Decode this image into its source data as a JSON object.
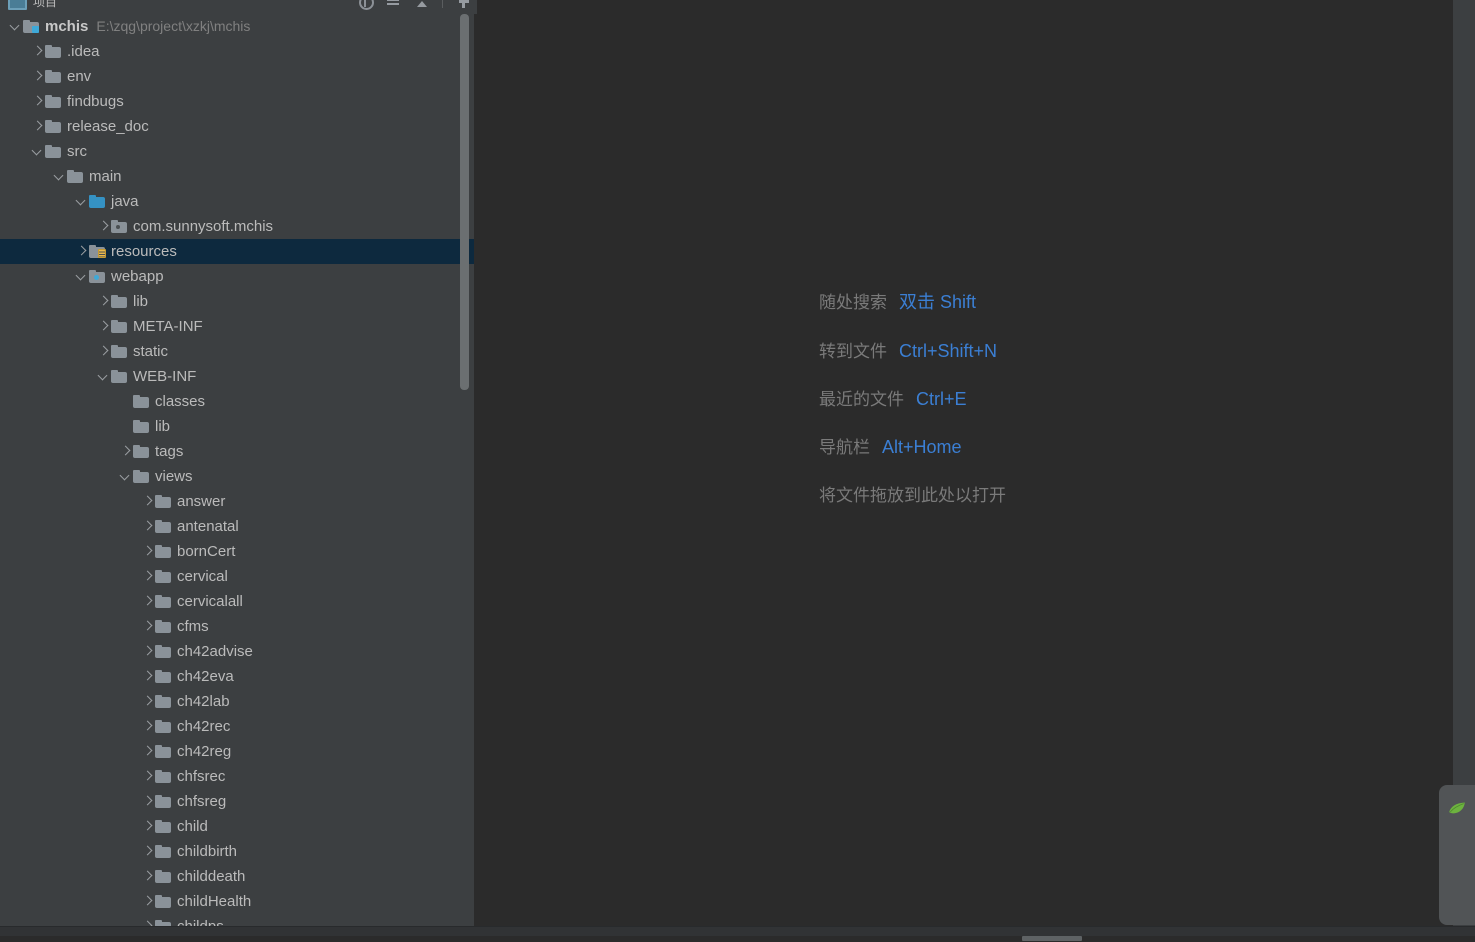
{
  "window": {
    "tool_window_title": "项目",
    "toolbar_icons": [
      "locate-icon",
      "collapse-all-icon",
      "hide-icon",
      "settings-icon"
    ]
  },
  "project_tree": {
    "root": {
      "name": "mchis",
      "path": "E:\\zqg\\project\\xzkj\\mchis"
    },
    "nodes": [
      {
        "label": "mchis",
        "path": "E:\\zqg\\project\\xzkj\\mchis",
        "indent": 0,
        "arrow": "down",
        "icon": "module-root-folder-icon",
        "bold": true,
        "selected": false
      },
      {
        "label": ".idea",
        "indent": 1,
        "arrow": "right",
        "icon": "folder-icon",
        "bold": false,
        "selected": false
      },
      {
        "label": "env",
        "indent": 1,
        "arrow": "right",
        "icon": "folder-icon",
        "bold": false,
        "selected": false
      },
      {
        "label": "findbugs",
        "indent": 1,
        "arrow": "right",
        "icon": "folder-icon",
        "bold": false,
        "selected": false
      },
      {
        "label": "release_doc",
        "indent": 1,
        "arrow": "right",
        "icon": "folder-icon",
        "bold": false,
        "selected": false
      },
      {
        "label": "src",
        "indent": 1,
        "arrow": "down",
        "icon": "folder-icon",
        "bold": false,
        "selected": false
      },
      {
        "label": "main",
        "indent": 2,
        "arrow": "down",
        "icon": "folder-icon",
        "bold": false,
        "selected": false
      },
      {
        "label": "java",
        "indent": 3,
        "arrow": "down",
        "icon": "source-root-folder-icon",
        "bold": false,
        "selected": false
      },
      {
        "label": "com.sunnysoft.mchis",
        "indent": 4,
        "arrow": "right",
        "icon": "package-icon",
        "bold": false,
        "selected": false
      },
      {
        "label": "resources",
        "indent": 3,
        "arrow": "right",
        "icon": "resource-root-folder-icon",
        "bold": false,
        "selected": true
      },
      {
        "label": "webapp",
        "indent": 3,
        "arrow": "down",
        "icon": "web-root-folder-icon",
        "bold": false,
        "selected": false
      },
      {
        "label": "lib",
        "indent": 4,
        "arrow": "right",
        "icon": "folder-icon",
        "bold": false,
        "selected": false
      },
      {
        "label": "META-INF",
        "indent": 4,
        "arrow": "right",
        "icon": "folder-icon",
        "bold": false,
        "selected": false
      },
      {
        "label": "static",
        "indent": 4,
        "arrow": "right",
        "icon": "folder-icon",
        "bold": false,
        "selected": false
      },
      {
        "label": "WEB-INF",
        "indent": 4,
        "arrow": "down",
        "icon": "folder-icon",
        "bold": false,
        "selected": false
      },
      {
        "label": "classes",
        "indent": 5,
        "arrow": "none",
        "icon": "folder-icon",
        "bold": false,
        "selected": false
      },
      {
        "label": "lib",
        "indent": 5,
        "arrow": "none",
        "icon": "folder-icon",
        "bold": false,
        "selected": false
      },
      {
        "label": "tags",
        "indent": 5,
        "arrow": "right",
        "icon": "folder-icon",
        "bold": false,
        "selected": false
      },
      {
        "label": "views",
        "indent": 5,
        "arrow": "down",
        "icon": "folder-icon",
        "bold": false,
        "selected": false
      },
      {
        "label": "answer",
        "indent": 6,
        "arrow": "right",
        "icon": "folder-icon",
        "bold": false,
        "selected": false
      },
      {
        "label": "antenatal",
        "indent": 6,
        "arrow": "right",
        "icon": "folder-icon",
        "bold": false,
        "selected": false
      },
      {
        "label": "bornCert",
        "indent": 6,
        "arrow": "right",
        "icon": "folder-icon",
        "bold": false,
        "selected": false
      },
      {
        "label": "cervical",
        "indent": 6,
        "arrow": "right",
        "icon": "folder-icon",
        "bold": false,
        "selected": false
      },
      {
        "label": "cervicalall",
        "indent": 6,
        "arrow": "right",
        "icon": "folder-icon",
        "bold": false,
        "selected": false
      },
      {
        "label": "cfms",
        "indent": 6,
        "arrow": "right",
        "icon": "folder-icon",
        "bold": false,
        "selected": false
      },
      {
        "label": "ch42advise",
        "indent": 6,
        "arrow": "right",
        "icon": "folder-icon",
        "bold": false,
        "selected": false
      },
      {
        "label": "ch42eva",
        "indent": 6,
        "arrow": "right",
        "icon": "folder-icon",
        "bold": false,
        "selected": false
      },
      {
        "label": "ch42lab",
        "indent": 6,
        "arrow": "right",
        "icon": "folder-icon",
        "bold": false,
        "selected": false
      },
      {
        "label": "ch42rec",
        "indent": 6,
        "arrow": "right",
        "icon": "folder-icon",
        "bold": false,
        "selected": false
      },
      {
        "label": "ch42reg",
        "indent": 6,
        "arrow": "right",
        "icon": "folder-icon",
        "bold": false,
        "selected": false
      },
      {
        "label": "chfsrec",
        "indent": 6,
        "arrow": "right",
        "icon": "folder-icon",
        "bold": false,
        "selected": false
      },
      {
        "label": "chfsreg",
        "indent": 6,
        "arrow": "right",
        "icon": "folder-icon",
        "bold": false,
        "selected": false
      },
      {
        "label": "child",
        "indent": 6,
        "arrow": "right",
        "icon": "folder-icon",
        "bold": false,
        "selected": false
      },
      {
        "label": "childbirth",
        "indent": 6,
        "arrow": "right",
        "icon": "folder-icon",
        "bold": false,
        "selected": false
      },
      {
        "label": "childdeath",
        "indent": 6,
        "arrow": "right",
        "icon": "folder-icon",
        "bold": false,
        "selected": false
      },
      {
        "label": "childHealth",
        "indent": 6,
        "arrow": "right",
        "icon": "folder-icon",
        "bold": false,
        "selected": false
      },
      {
        "label": "childps",
        "indent": 6,
        "arrow": "right",
        "icon": "folder-icon",
        "bold": false,
        "selected": false
      }
    ]
  },
  "editor": {
    "hints": [
      {
        "label": "随处搜索",
        "key": "双击 Shift"
      },
      {
        "label": "转到文件",
        "key": "Ctrl+Shift+N"
      },
      {
        "label": "最近的文件",
        "key": "Ctrl+E"
      },
      {
        "label": "导航栏",
        "key": "Alt+Home"
      }
    ],
    "drop_hint": "将文件拖放到此处以打开"
  },
  "right_stripe": {
    "spring_button": "spring-leaf-icon"
  },
  "colors": {
    "panel_bg": "#3c3f41",
    "editor_bg": "#2b2b2b",
    "selection_bg": "#0d293e",
    "text": "#bbbbbb",
    "muted_text": "#808080",
    "accent_blue": "#3b7fd4",
    "source_root": "#3592c4",
    "resource_yellow": "#e8b84b",
    "spring_green": "#6db33f"
  }
}
